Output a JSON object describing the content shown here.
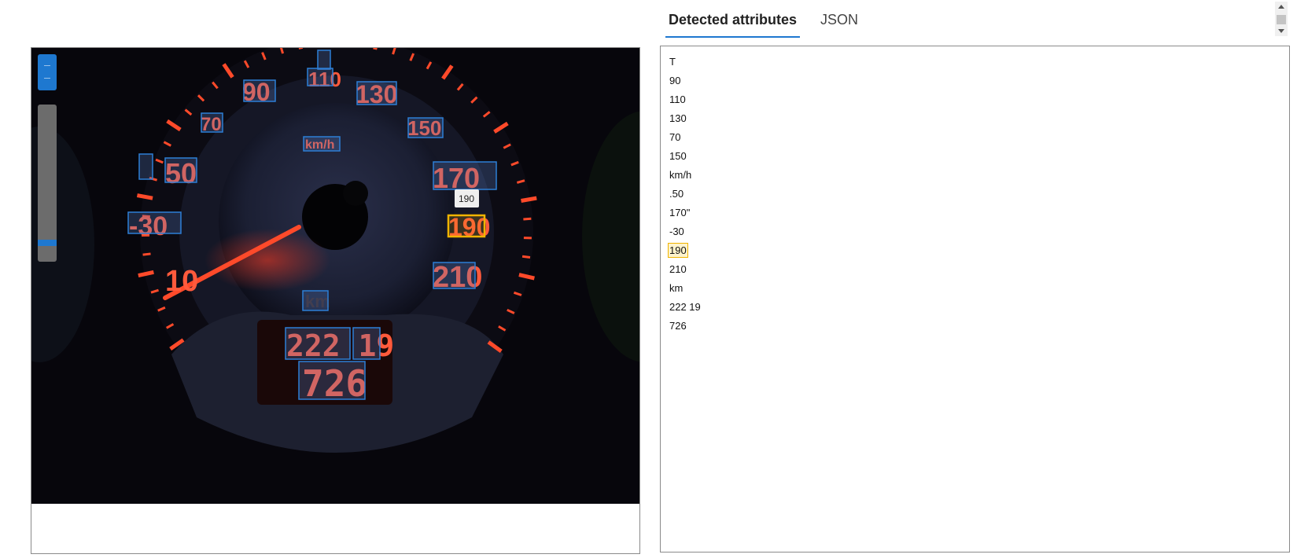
{
  "tabs": [
    {
      "label": "Detected attributes",
      "active": true
    },
    {
      "label": "JSON",
      "active": false
    }
  ],
  "attributes": [
    "T",
    "90",
    "110",
    "130",
    "70",
    "150",
    "km/h",
    ".50",
    "170\"",
    "-30",
    "190",
    "210",
    "km",
    "222 19",
    "726"
  ],
  "highlighted_attribute": "190",
  "tooltip": "190",
  "gauge": {
    "labels": [
      "10",
      "-30",
      "50",
      "70",
      "90",
      "110",
      "130",
      "150",
      "170",
      "190",
      "210"
    ],
    "unit": "km/h",
    "unit_bottom": "km",
    "odometer_line1": "222 19",
    "odometer_line2": "726"
  },
  "colors": {
    "accent": "#1e78d0",
    "box": "#2d7fd6",
    "highlight_box": "#f0b400",
    "gauge_red": "#ff4a2a"
  }
}
